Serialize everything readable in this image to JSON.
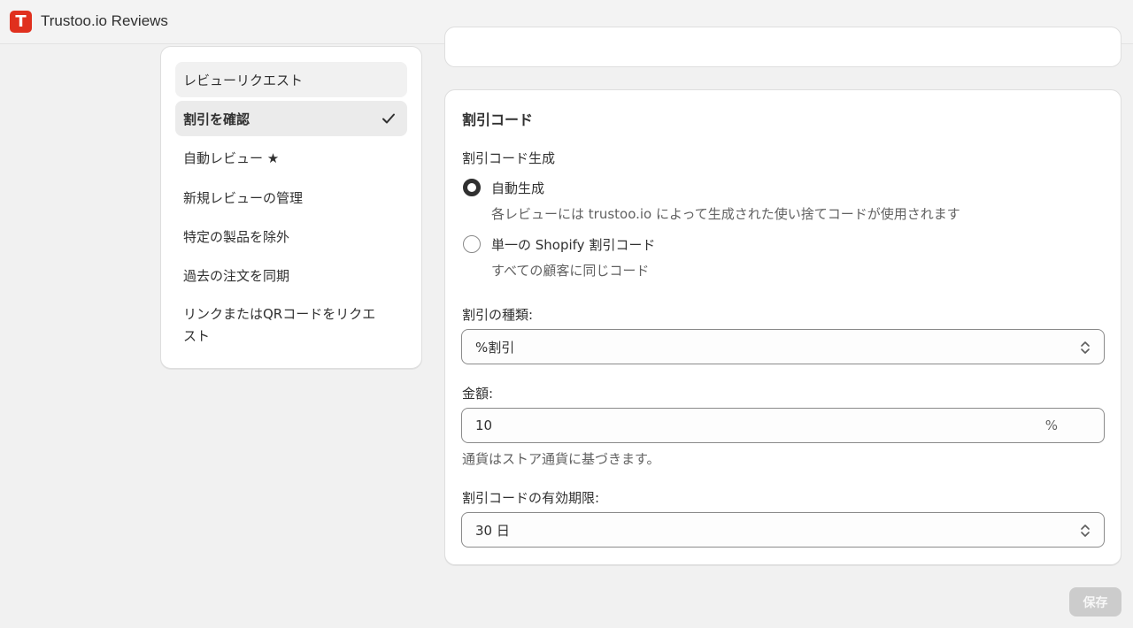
{
  "app": {
    "logo_letter": "T",
    "title": "Trustoo.io Reviews"
  },
  "sidebar": {
    "items": [
      {
        "label": "レビューリクエスト"
      },
      {
        "label": "割引を確認"
      },
      {
        "label": "自動レビュー ★"
      },
      {
        "label": "新規レビューの管理"
      },
      {
        "label": "特定の製品を除外"
      },
      {
        "label": "過去の注文を同期"
      },
      {
        "label": "リンクまたはQRコードをリクエ",
        "label_line2": "スト"
      }
    ]
  },
  "discount_card": {
    "title": "割引コード",
    "generation_label": "割引コード生成",
    "options": [
      {
        "label": "自動生成",
        "description": "各レビューには trustoo.io によって生成された使い捨てコードが使用されます",
        "checked": true
      },
      {
        "label": "単一の Shopify 割引コード",
        "description": "すべての顧客に同じコード",
        "checked": false
      }
    ],
    "discount_type": {
      "label": "割引の種類:",
      "value": "%割引"
    },
    "amount": {
      "label": "金額:",
      "value": "10",
      "suffix": "%",
      "helper": "通貨はストア通貨に基づきます。"
    },
    "expiry": {
      "label": "割引コードの有効期限:",
      "value": "30 日"
    }
  },
  "footer": {
    "save_label": "保存"
  },
  "colors": {
    "brand": "#e0301e",
    "save_disabled": "#cccccc"
  }
}
